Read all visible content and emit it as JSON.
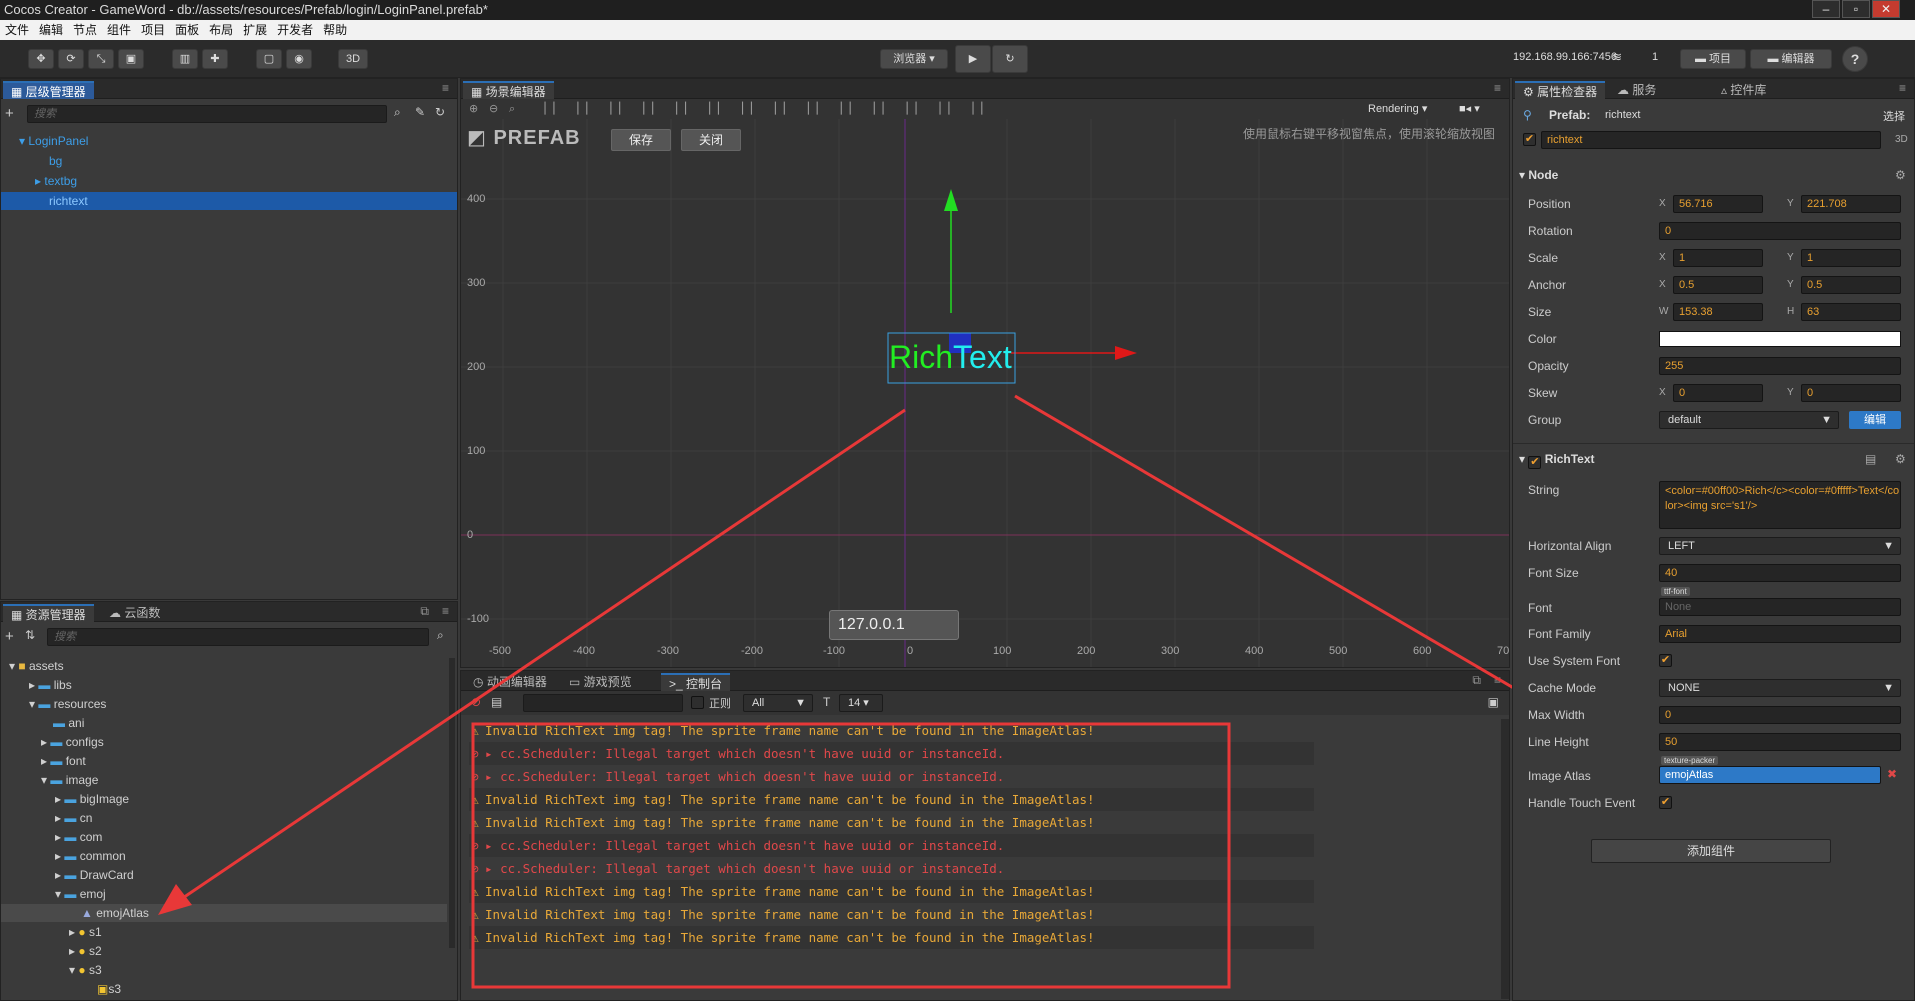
{
  "window": {
    "title": "Cocos Creator - GameWord - db://assets/resources/Prefab/login/LoginPanel.prefab*"
  },
  "menu": [
    "文件",
    "编辑",
    "节点",
    "组件",
    "项目",
    "面板",
    "布局",
    "扩展",
    "开发者",
    "帮助"
  ],
  "toolbar": {
    "btn3d": "3D",
    "preview": "浏览器 ▾",
    "ip": "192.168.99.166:7456",
    "count": "1",
    "project": "项目",
    "editor": "编辑器",
    "help": "?"
  },
  "hierarchy": {
    "tab": "层级管理器",
    "search_placeholder": "搜索",
    "nodes": [
      "LoginPanel",
      "bg",
      "textbg",
      "richtext"
    ]
  },
  "assets": {
    "tab": "资源管理器",
    "tab2": "云函数",
    "search_placeholder": "搜索",
    "items": [
      "assets",
      "libs",
      "resources",
      "ani",
      "configs",
      "font",
      "image",
      "bigImage",
      "cn",
      "com",
      "common",
      "DrawCard",
      "emoj",
      "emojAtlas",
      "s1",
      "s2",
      "s3",
      "s3"
    ]
  },
  "scene": {
    "tab": "场景编辑器",
    "rendering": "Rendering",
    "prefab": "PREFAB",
    "save": "保存",
    "close": "关闭",
    "hint": "使用鼠标右键平移视窗焦点，使用滚轮缩放视图",
    "ip_label": "127.0.0.1",
    "rich_green": "Rich",
    "rich_cyan": "Text",
    "y_labels": [
      "400",
      "300",
      "200",
      "100",
      "0",
      "-100"
    ],
    "x_labels": [
      "-500",
      "-400",
      "-300",
      "-200",
      "-100",
      "0",
      "100",
      "200",
      "300",
      "400",
      "500",
      "600",
      "70"
    ]
  },
  "console": {
    "tabs": [
      "动画编辑器",
      "游戏预览",
      "控制台"
    ],
    "regex": "正则",
    "filter": "All",
    "font_size": "14",
    "logs": [
      {
        "type": "warn",
        "text": "Invalid RichText img tag! The sprite frame name can't be found in the ImageAtlas!"
      },
      {
        "type": "err",
        "text": "cc.Scheduler: Illegal target which doesn't have uuid or instanceId."
      },
      {
        "type": "err",
        "text": "cc.Scheduler: Illegal target which doesn't have uuid or instanceId."
      },
      {
        "type": "warn",
        "text": "Invalid RichText img tag! The sprite frame name can't be found in the ImageAtlas!"
      },
      {
        "type": "warn",
        "text": "Invalid RichText img tag! The sprite frame name can't be found in the ImageAtlas!"
      },
      {
        "type": "err",
        "text": "cc.Scheduler: Illegal target which doesn't have uuid or instanceId."
      },
      {
        "type": "err",
        "text": "cc.Scheduler: Illegal target which doesn't have uuid or instanceId."
      },
      {
        "type": "warn",
        "text": "Invalid RichText img tag! The sprite frame name can't be found in the ImageAtlas!"
      },
      {
        "type": "warn",
        "text": "Invalid RichText img tag! The sprite frame name can't be found in the ImageAtlas!"
      },
      {
        "type": "warn",
        "text": "Invalid RichText img tag! The sprite frame name can't be found in the ImageAtlas!"
      }
    ]
  },
  "inspector": {
    "tabs": [
      "属性检查器",
      "服务",
      "控件库"
    ],
    "prefab_label": "Prefab:",
    "prefab_name": "richtext",
    "select": "选择",
    "node_name": "richtext",
    "node_3d": "3D",
    "node_section": "Node",
    "position_label": "Position",
    "position_x": "56.716",
    "position_y": "221.708",
    "rotation_label": "Rotation",
    "rotation": "0",
    "scale_label": "Scale",
    "scale_x": "1",
    "scale_y": "1",
    "anchor_label": "Anchor",
    "anchor_x": "0.5",
    "anchor_y": "0.5",
    "size_label": "Size",
    "size_w": "153.38",
    "size_h": "63",
    "color_label": "Color",
    "opacity_label": "Opacity",
    "opacity": "255",
    "skew_label": "Skew",
    "skew_x": "0",
    "skew_y": "0",
    "group_label": "Group",
    "group": "default",
    "group_edit": "编辑",
    "richtext_section": "RichText",
    "string_label": "String",
    "string": "<color=#00ff00>Rich</c><color=#0fffff>Text</color><img src='s1'/>",
    "halign_label": "Horizontal Align",
    "halign": "LEFT",
    "fontsize_label": "Font Size",
    "fontsize": "40",
    "font_label": "Font",
    "font_tag": "ttf-font",
    "font": "None",
    "fontfamily_label": "Font Family",
    "fontfamily": "Arial",
    "usesys_label": "Use System Font",
    "cache_label": "Cache Mode",
    "cache": "NONE",
    "maxwidth_label": "Max Width",
    "maxwidth": "0",
    "lineheight_label": "Line Height",
    "lineheight": "50",
    "atlas_label": "Image Atlas",
    "atlas_tag": "texture-packer",
    "atlas": "emojAtlas",
    "touch_label": "Handle Touch Event",
    "add_component": "添加组件"
  }
}
